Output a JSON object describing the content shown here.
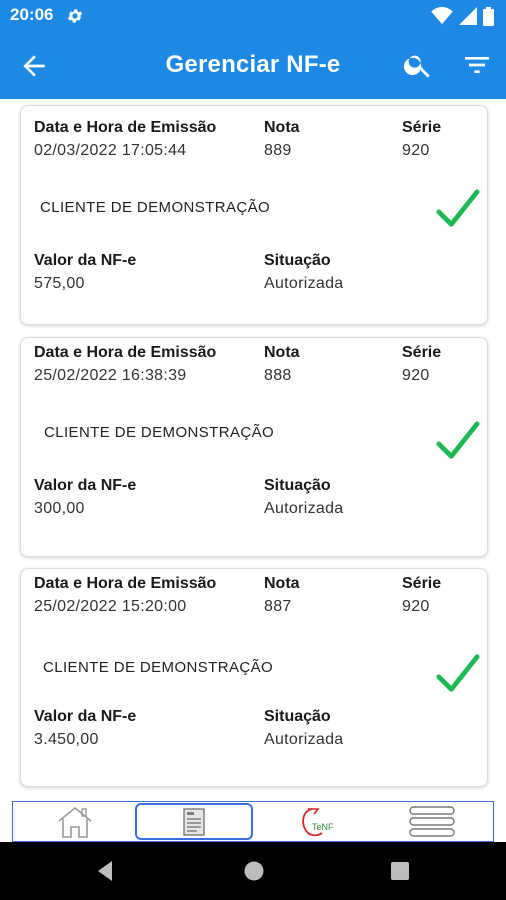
{
  "status_bar": {
    "time": "20:06"
  },
  "app_bar": {
    "title": "Gerenciar NF-e"
  },
  "labels": {
    "emission": "Data e Hora de Emissão",
    "note": "Nota",
    "series": "Série",
    "value": "Valor da NF-e",
    "status": "Situação"
  },
  "cards": [
    {
      "datetime": "02/03/2022 17:05:44",
      "note": "889",
      "series": "920",
      "client": "CLIENTE DE DEMONSTRAÇÃO",
      "value": "575,00",
      "status": "Autorizada"
    },
    {
      "datetime": "25/02/2022 16:38:39",
      "note": "888",
      "series": "920",
      "client": "CLIENTE DE DEMONSTRAÇÃO",
      "value": "300,00",
      "status": "Autorizada"
    },
    {
      "datetime": "25/02/2022 15:20:00",
      "note": "887",
      "series": "920",
      "client": "CLIENTE DE DEMONSTRAÇÃO",
      "value": "3.450,00",
      "status": "Autorizada"
    }
  ],
  "bottom_nav": {
    "items": [
      "home-icon",
      "document-icon",
      "nfe-logo-icon",
      "menu-icon"
    ],
    "logo_text": "TeNF"
  },
  "colors": {
    "primary": "#1e88e5",
    "check": "#1db954",
    "nav_border": "#3f6fd8"
  }
}
